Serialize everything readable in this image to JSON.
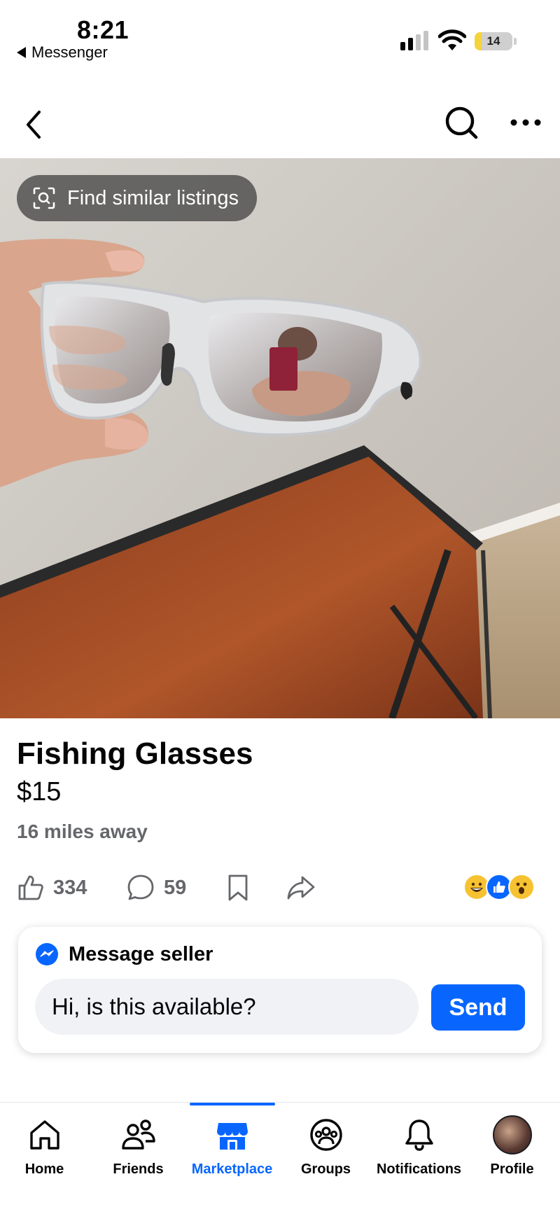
{
  "status_bar": {
    "time": "8:21",
    "back_app": "Messenger",
    "battery": "14",
    "battery_color": "#f5d33a"
  },
  "header": {
    "back_icon": "chevron-left-icon",
    "search_icon": "search-icon",
    "more_icon": "more-horizontal-icon"
  },
  "photo": {
    "find_similar_label": "Find similar listings",
    "find_similar_icon": "image-search-icon"
  },
  "listing": {
    "title": "Fishing Glasses",
    "price": "$15",
    "distance": "16 miles away"
  },
  "actions": {
    "likes": "334",
    "comments": "59",
    "save_icon": "bookmark-icon",
    "share_icon": "share-icon",
    "reactions": [
      "grinning-face",
      "thumbs-up",
      "surprised-face"
    ]
  },
  "message": {
    "header": "Message seller",
    "input_value": "Hi, is this available?",
    "send_label": "Send",
    "accent": "#0866ff"
  },
  "tabs": [
    {
      "label": "Home",
      "icon": "home-icon"
    },
    {
      "label": "Friends",
      "icon": "friends-icon"
    },
    {
      "label": "Marketplace",
      "icon": "marketplace-icon",
      "active": true
    },
    {
      "label": "Groups",
      "icon": "groups-icon"
    },
    {
      "label": "Notifications",
      "icon": "bell-icon"
    },
    {
      "label": "Profile",
      "icon": "avatar"
    }
  ]
}
